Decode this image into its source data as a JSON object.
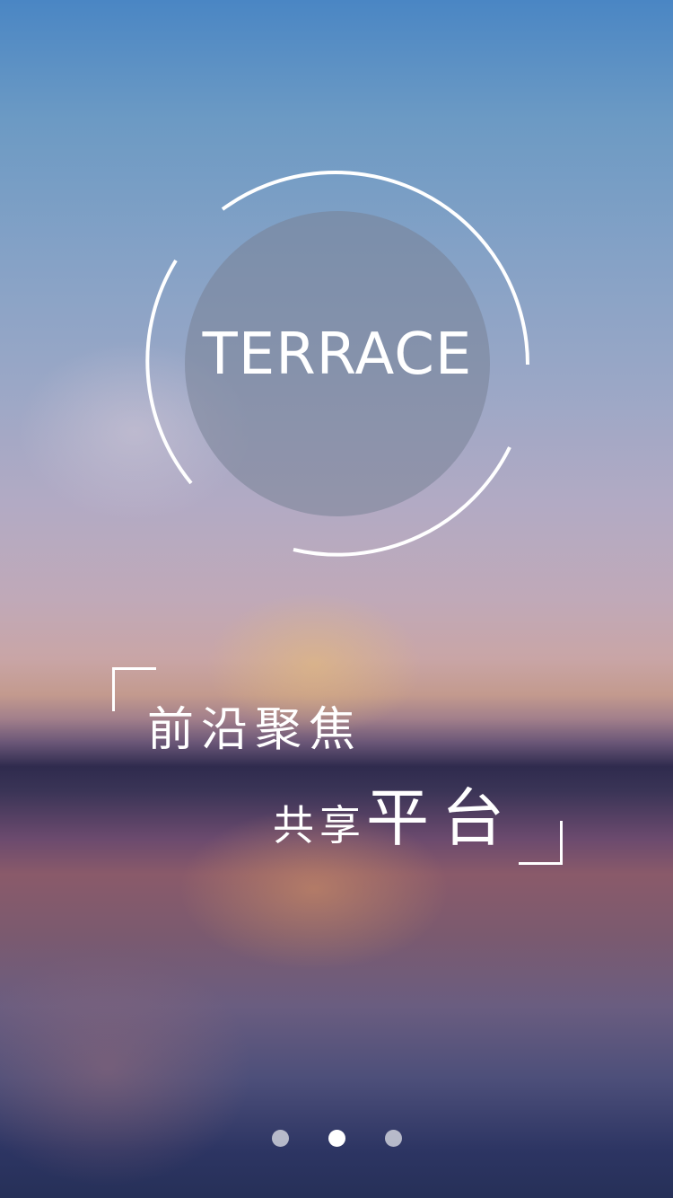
{
  "splash": {
    "logo_text": "TERRACE",
    "slogan": {
      "line1": "前沿聚焦",
      "line2_small": "共享",
      "line2_big": "平台"
    }
  },
  "pager": {
    "total": 3,
    "active_index": 1
  },
  "colors": {
    "text": "#ffffff",
    "sky_top": "#4a86c4",
    "horizon": "#2f2b4e",
    "bottom": "#263058",
    "logo_disc": "#78829a"
  }
}
